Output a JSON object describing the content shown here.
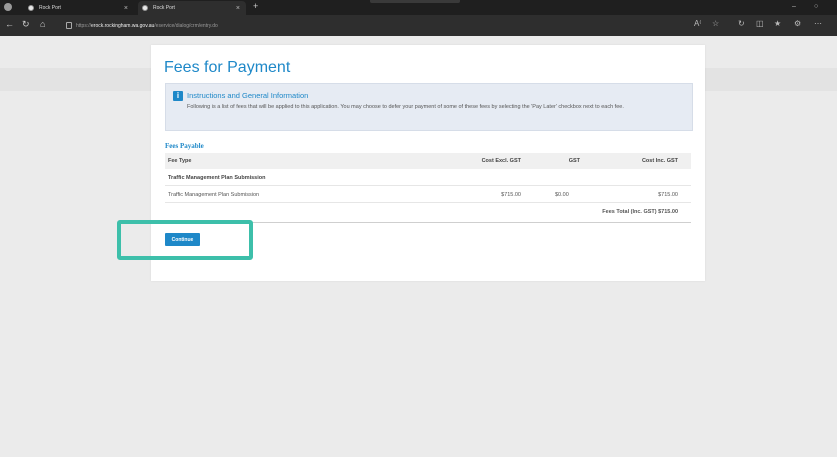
{
  "browser": {
    "tabs": [
      {
        "title": "Rock Port"
      },
      {
        "title": "Rock Port"
      }
    ],
    "url_scheme": "https://",
    "url_host": "erock.rockingham.wa.gov.au",
    "url_path": "/eservice/dialog/crm/entry.do",
    "new_tab": "+",
    "close": "×",
    "minimize": "–"
  },
  "page": {
    "title": "Fees for Payment",
    "info": {
      "icon": "info-icon",
      "title": "Instructions and General Information",
      "body": "Following is a list of fees that will be applied to this application. You may choose to defer your payment of some of these fees by selecting the 'Pay Later' checkbox next to each fee."
    },
    "fees_section_label": "Fees Payable",
    "table": {
      "headers": [
        "Fee Type",
        "Cost Excl. GST",
        "GST",
        "Cost Inc. GST"
      ],
      "group": "Traffic Management Plan Submission",
      "item": {
        "name": "Traffic Management Plan Submission",
        "cost_excl": "$715.00",
        "gst": "$0.00",
        "cost_inc": "$715.00"
      },
      "total": "Fees Total (Inc. GST) $715.00"
    },
    "continue_label": "Continue"
  },
  "colors": {
    "accent": "#1e88c8",
    "highlight": "#3dbfaa"
  }
}
